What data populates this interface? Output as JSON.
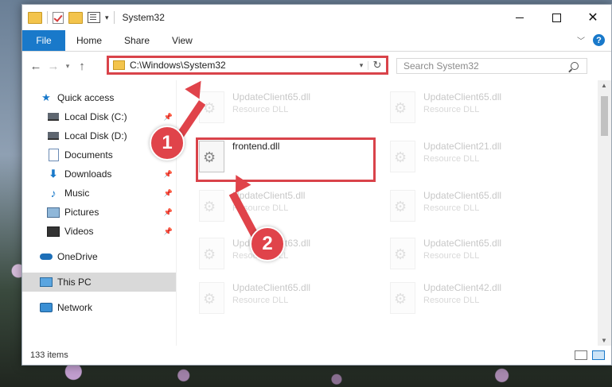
{
  "window": {
    "title": "System32",
    "controls": {
      "minimize": "minimize-icon",
      "maximize": "maximize-icon",
      "close": "✕"
    }
  },
  "ribbon": {
    "tabs": [
      "File",
      "Home",
      "Share",
      "View"
    ],
    "help": "?"
  },
  "nav": {
    "address": "C:\\Windows\\System32",
    "search_placeholder": "Search System32"
  },
  "sidebar": {
    "items": [
      {
        "label": "Quick access",
        "icon": "star-icon"
      },
      {
        "label": "Local Disk (C:)",
        "icon": "drive-icon"
      },
      {
        "label": "Local Disk (D:)",
        "icon": "drive-icon"
      },
      {
        "label": "Documents",
        "icon": "documents-icon"
      },
      {
        "label": "Downloads",
        "icon": "downloads-icon"
      },
      {
        "label": "Music",
        "icon": "music-icon"
      },
      {
        "label": "Pictures",
        "icon": "pictures-icon"
      },
      {
        "label": "Videos",
        "icon": "videos-icon"
      },
      {
        "label": "OneDrive",
        "icon": "onedrive-icon"
      },
      {
        "label": "This PC",
        "icon": "pc-icon"
      },
      {
        "label": "Network",
        "icon": "network-icon"
      }
    ]
  },
  "files": [
    {
      "name": "UpdateClient65.dll",
      "type": "Resource DLL"
    },
    {
      "name": "UpdateClient65.dll",
      "type": "Resource DLL"
    },
    {
      "name": "frontend.dll",
      "type": ""
    },
    {
      "name": "UpdateClient21.dll",
      "type": "Resource DLL"
    },
    {
      "name": "UpdateClient5.dll",
      "type": "Resource DLL"
    },
    {
      "name": "UpdateClient65.dll",
      "type": "Resource DLL"
    },
    {
      "name": "UpdateClient63.dll",
      "type": "Resource DLL"
    },
    {
      "name": "UpdateClient65.dll",
      "type": "Resource DLL"
    },
    {
      "name": "UpdateClient65.dll",
      "type": "Resource DLL"
    },
    {
      "name": "UpdateClient42.dll",
      "type": "Resource DLL"
    }
  ],
  "status": {
    "count": "133 items"
  },
  "annotations": {
    "step1": "1",
    "step2": "2"
  },
  "colors": {
    "accent": "#1979ca",
    "highlight": "#d9434a"
  }
}
